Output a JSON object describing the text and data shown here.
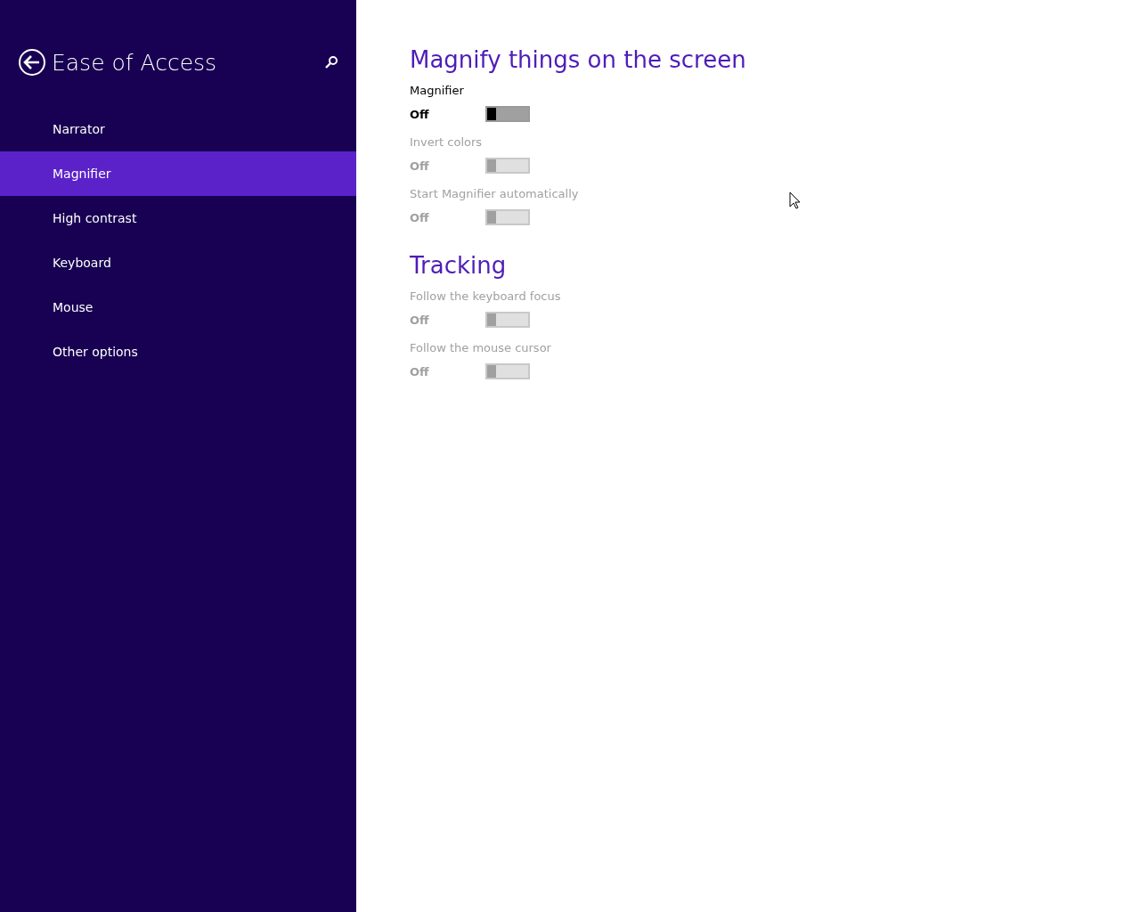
{
  "sidebar": {
    "title": "Ease of Access",
    "items": [
      {
        "label": "Narrator",
        "selected": false
      },
      {
        "label": "Magnifier",
        "selected": true
      },
      {
        "label": "High contrast",
        "selected": false
      },
      {
        "label": "Keyboard",
        "selected": false
      },
      {
        "label": "Mouse",
        "selected": false
      },
      {
        "label": "Other options",
        "selected": false
      }
    ]
  },
  "sections": [
    {
      "heading": "Magnify things on the screen",
      "settings": [
        {
          "label": "Magnifier",
          "state_text": "Off",
          "on": false,
          "disabled": false
        },
        {
          "label": "Invert colors",
          "state_text": "Off",
          "on": false,
          "disabled": true
        },
        {
          "label": "Start Magnifier automatically",
          "state_text": "Off",
          "on": false,
          "disabled": true
        }
      ]
    },
    {
      "heading": "Tracking",
      "settings": [
        {
          "label": "Follow the keyboard focus",
          "state_text": "Off",
          "on": false,
          "disabled": true
        },
        {
          "label": "Follow the mouse cursor",
          "state_text": "Off",
          "on": false,
          "disabled": true
        }
      ]
    }
  ]
}
